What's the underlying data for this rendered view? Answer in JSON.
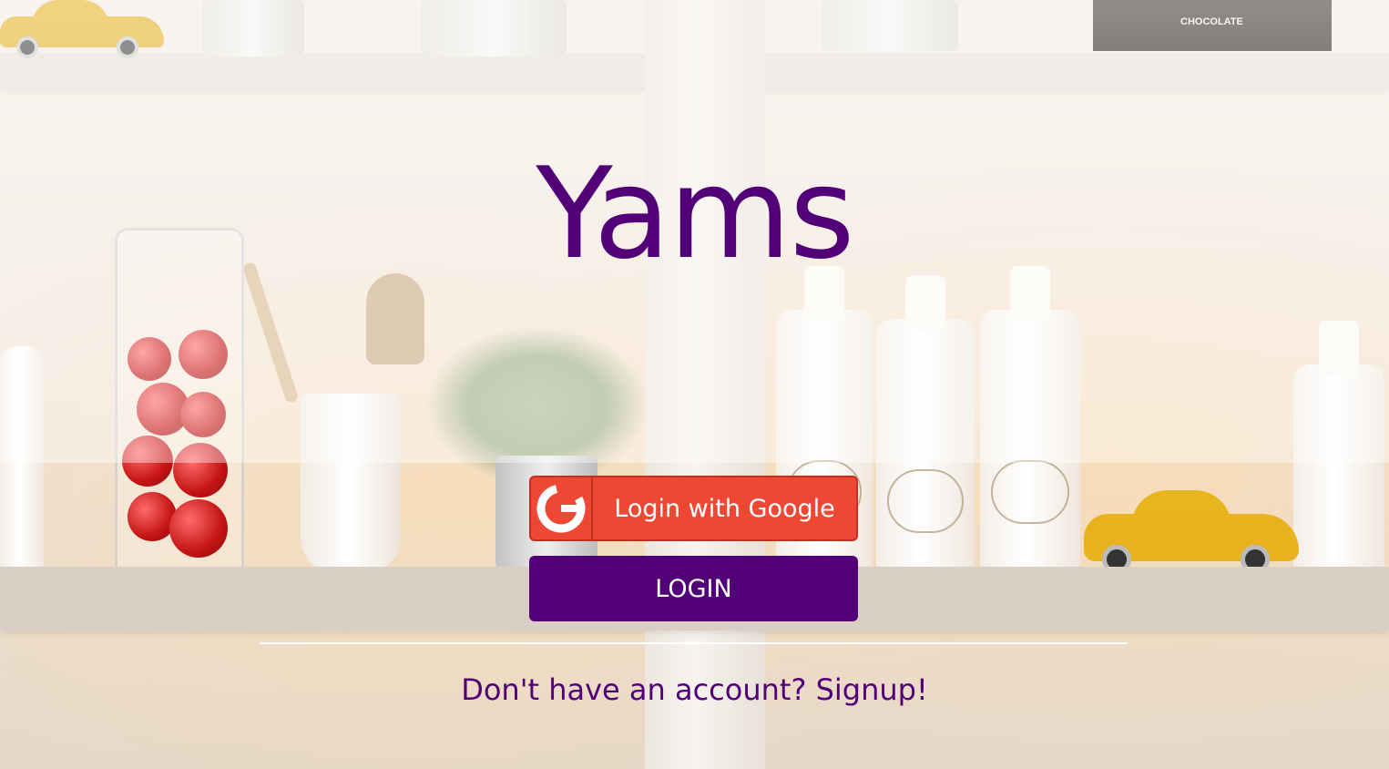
{
  "app": {
    "title": "Yams"
  },
  "auth": {
    "google_button_label": "Login with Google",
    "login_button_label": "LOGIN",
    "signup_link_label": "Don't have an account? Signup!"
  },
  "icons": {
    "google": "google-g-icon"
  },
  "background": {
    "books_label": "CHOCOLATE"
  },
  "colors": {
    "brand_purple": "#520077",
    "google_red": "#ee4734",
    "google_border": "#c2301f",
    "button_text": "#ffffff"
  }
}
